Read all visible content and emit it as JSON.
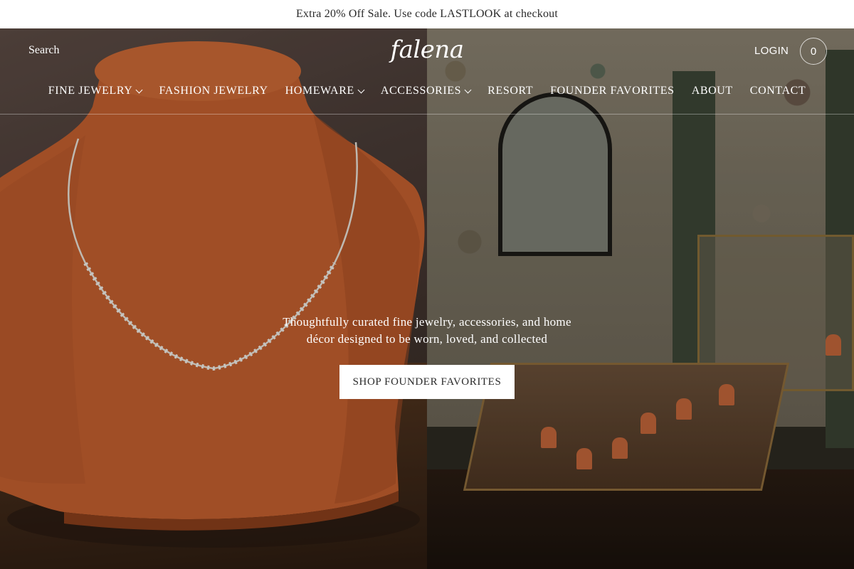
{
  "announcement": {
    "text": "Extra 20% Off Sale. Use code LASTLOOK at checkout"
  },
  "header": {
    "search_label": "Search",
    "logo_text": "falena",
    "login_label": "LOGIN",
    "cart_count": "0"
  },
  "nav": {
    "items": [
      {
        "label": "FINE JEWELRY",
        "has_dropdown": true
      },
      {
        "label": "FASHION JEWELRY",
        "has_dropdown": false
      },
      {
        "label": "HOMEWARE",
        "has_dropdown": true
      },
      {
        "label": "ACCESSORIES",
        "has_dropdown": true
      },
      {
        "label": "RESORT",
        "has_dropdown": false
      },
      {
        "label": "FOUNDER FAVORITES",
        "has_dropdown": false
      },
      {
        "label": "ABOUT",
        "has_dropdown": false
      },
      {
        "label": "CONTACT",
        "has_dropdown": false
      }
    ]
  },
  "hero": {
    "tagline_line1": "Thoughtfully curated fine jewelry, accessories, and home",
    "tagline_line2": "décor designed to be worn, loved, and collected",
    "cta_label": "SHOP FOUNDER FAVORITES"
  },
  "colors": {
    "announcement_bg": "#ffffff",
    "cta_bg": "#ffffff",
    "text_on_hero": "#ffffff",
    "bust_orange": "#c4602f"
  }
}
